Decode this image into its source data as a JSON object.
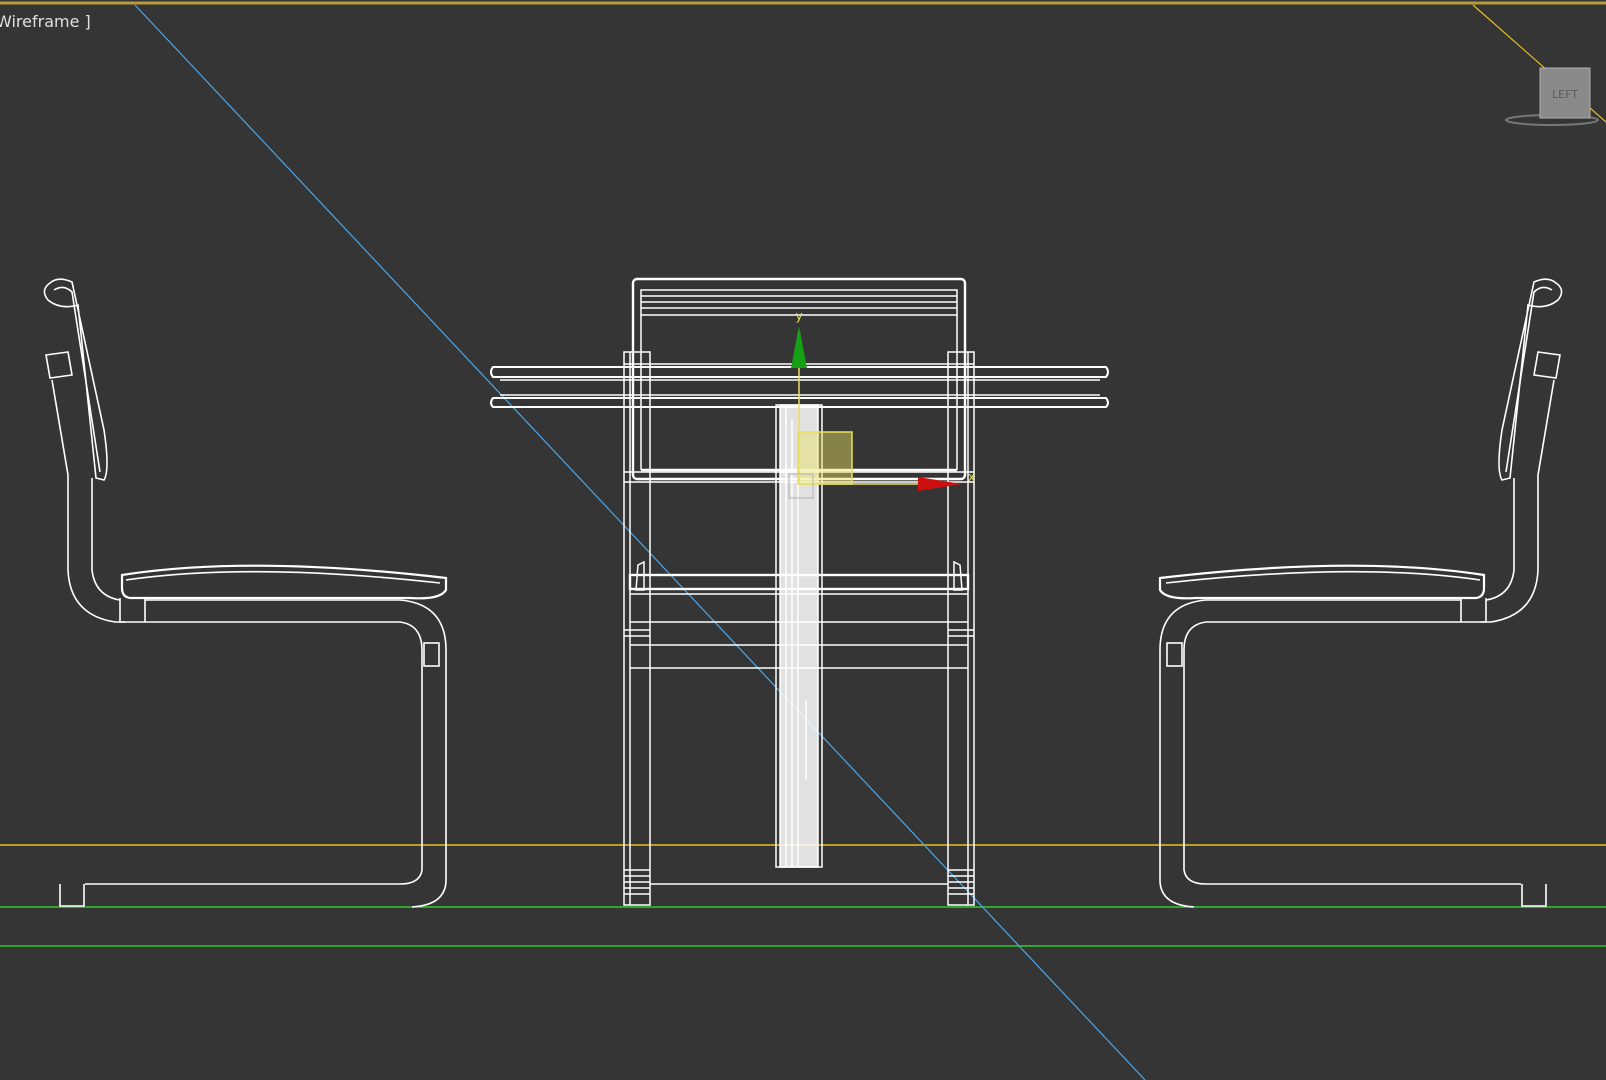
{
  "viewport": {
    "label": "Wireframe ]",
    "background": "#353535"
  },
  "viewcube": {
    "face_label": "LEFT"
  },
  "gizmo": {
    "y_axis_label": "y",
    "x_axis_label": "x"
  },
  "colors": {
    "wire": "#ffffff",
    "horizon": "#e8c020",
    "ground": "#2ecc2e",
    "camera_line": "#4aa6e8",
    "gizmo_y": "#16a016",
    "gizmo_x": "#cc1010",
    "gizmo_plane": "#e8e060",
    "top_border": "#b89a3a"
  }
}
